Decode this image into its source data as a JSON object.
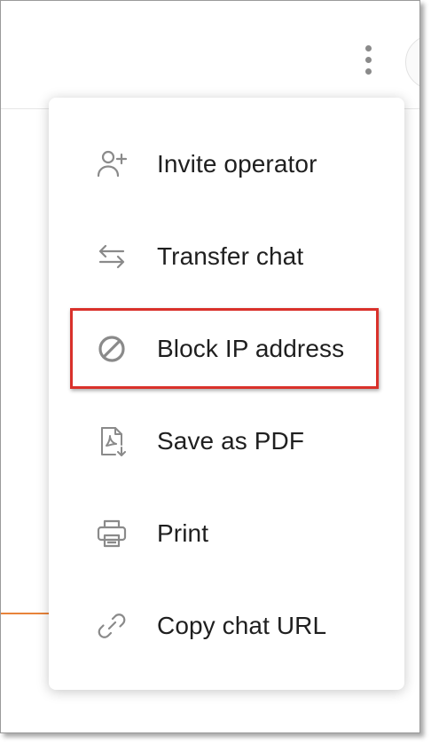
{
  "menu": {
    "items": [
      {
        "label": "Invite operator",
        "icon": "person-add-icon"
      },
      {
        "label": "Transfer chat",
        "icon": "transfer-arrows-icon"
      },
      {
        "label": "Block IP address",
        "icon": "block-icon"
      },
      {
        "label": "Save as PDF",
        "icon": "pdf-document-icon"
      },
      {
        "label": "Print",
        "icon": "printer-icon"
      },
      {
        "label": "Copy chat URL",
        "icon": "link-icon"
      }
    ]
  },
  "colors": {
    "highlight_border": "#d9312b",
    "accent_line": "#e8833a",
    "icon_gray": "#8a8a8a",
    "text": "#1f1f1f"
  },
  "highlighted_item": "Block IP address"
}
